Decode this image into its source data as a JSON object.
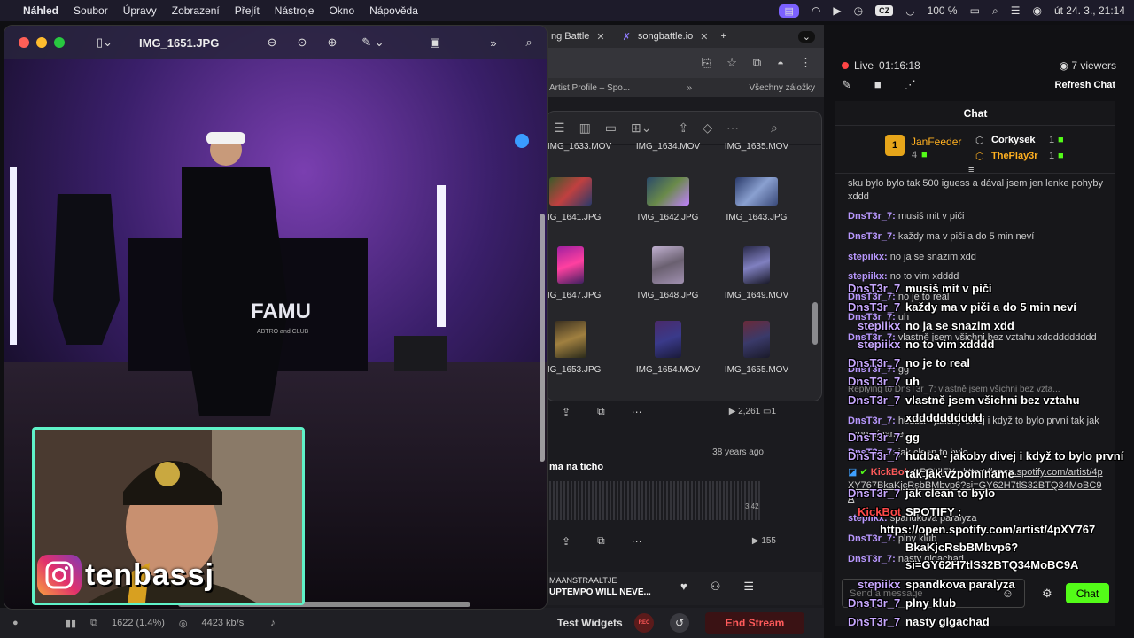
{
  "menubar": {
    "app": "Náhled",
    "items": [
      "Soubor",
      "Úpravy",
      "Zobrazení",
      "Přejít",
      "Nástroje",
      "Okno",
      "Nápověda"
    ],
    "lang": "CZ",
    "battery": "100 %",
    "datetime": "út 24. 3., 21:14"
  },
  "browser": {
    "tabs": [
      {
        "label": "ng Battle"
      },
      {
        "label": "songbattle.io"
      }
    ],
    "bookmark_left": "Artist Profile – Spo...",
    "bookmark_right": "Všechny záložky"
  },
  "finder": {
    "files": [
      "IMG_1633.MOV",
      "IMG_1634.MOV",
      "IMG_1635.MOV",
      "IMG_1641.JPG",
      "IMG_1642.JPG",
      "IMG_1643.JPG",
      "IMG_1647.JPG",
      "IMG_1648.JPG",
      "IMG_1649.MOV",
      "IMG_1653.JPG",
      "IMG_1654.MOV",
      "IMG_1655.MOV"
    ]
  },
  "feed": {
    "post1_count": "2,261",
    "post1_comments": "1",
    "ago": "38 years ago",
    "caption": "ma na ticho",
    "duration": "3:42",
    "post2_count": "155",
    "player_artist": "MAANSTRAALTJE",
    "player_title": "UPTEMPO WILL NEVE..."
  },
  "preview": {
    "title": "IMG_1651.JPG",
    "photo_sign": "FAMU",
    "photo_subsign": "ABTRO and CLUB"
  },
  "webcam": {
    "ig_handle": "tenbassj"
  },
  "streambar": {
    "frames": "1622 (1.4%)",
    "bitrate": "4423 kb/s",
    "test_widgets": "Test Widgets",
    "rec": "REC",
    "end_stream": "End Stream"
  },
  "stream": {
    "live": "Live",
    "timer": "01:16:18",
    "viewers": "7 viewers",
    "refresh": "Refresh Chat"
  },
  "chat": {
    "header": "Chat",
    "leaderboard": {
      "first_name": "JanFeeder",
      "first_count": "4",
      "second_name": "Corkysek",
      "second_count": "1",
      "third_name": "ThePlay3r",
      "third_count": "1"
    },
    "messages": [
      {
        "user": "",
        "text": "sku bylo bylo tak 500 iguess a dával jsem jen lenke pohyby xddd"
      },
      {
        "user": "DnsT3r_7:",
        "text": "musiš mit v piči"
      },
      {
        "user": "DnsT3r_7:",
        "text": "každy ma v piči a do 5 min neví"
      },
      {
        "user": "stepiikx:",
        "text": "no ja se snazim xdd"
      },
      {
        "user": "stepiikx:",
        "text": "no to vim xdddd"
      },
      {
        "user": "DnsT3r_7:",
        "text": "no je to real"
      },
      {
        "user": "DnsT3r_7:",
        "text": "uh"
      },
      {
        "user": "DnsT3r_7:",
        "text": "vlastně jsem všichni bez vztahu xdddddddddd"
      },
      {
        "user": "DnsT3r_7:",
        "text": "gg"
      },
      {
        "user": "",
        "text": "Replying to DnsT3r_7: vlastně jsem všichni bez vzta..."
      },
      {
        "user": "DnsT3r_7:",
        "text": "hudba - jakoby divej i když to bylo první tak jak vzpomíname"
      },
      {
        "user": "DnsT3r_7:",
        "text": "jak clean to bylo"
      },
      {
        "user": "KickBot:",
        "text": "SPOTIFY : https://open.spotify.com/artist/4pXY767BkaKjcRsbBMbvp6?si=GY62H7tlS32BTQ34MoBC9A"
      },
      {
        "user": "stepiikx:",
        "text": "spandkova paralyza"
      },
      {
        "user": "DnsT3r_7:",
        "text": "plny klub"
      },
      {
        "user": "DnsT3r_7:",
        "text": "nasty gigachad"
      }
    ],
    "input_placeholder": "Send a message",
    "send_label": "Chat"
  },
  "overlay": [
    {
      "user": "DnsT3r_7",
      "text": "musiš mit v piči"
    },
    {
      "user": "DnsT3r_7",
      "text": "každy ma v piči a do 5 min neví"
    },
    {
      "user": "stepiikx",
      "text": "no ja se snazim xdd"
    },
    {
      "user": "stepiikx",
      "text": "no to vim xdddd"
    },
    {
      "user": "DnsT3r_7",
      "text": "no je to real"
    },
    {
      "user": "DnsT3r_7",
      "text": "uh"
    },
    {
      "user": "DnsT3r_7",
      "text": "vlastně jsem všichni bez vztahu"
    },
    {
      "user": "",
      "text": "xdddddddddd"
    },
    {
      "user": "DnsT3r_7",
      "text": "gg"
    },
    {
      "user": "DnsT3r_7",
      "text": "hudba - jakoby divej i když to bylo první"
    },
    {
      "user": "",
      "text": "tak jak vzpomíname"
    },
    {
      "user": "DnsT3r_7",
      "text": "jak clean to bylo"
    },
    {
      "user": "KickBot",
      "text": "SPOTIFY :"
    },
    {
      "user": "",
      "text": "https://open.spotify.com/artist/4pXY767"
    },
    {
      "user": "",
      "text": "BkaKjcRsbBMbvp6?"
    },
    {
      "user": "",
      "text": "si=GY62H7tlS32BTQ34MoBC9A"
    },
    {
      "user": "stepiikx",
      "text": "spandkova paralyza"
    },
    {
      "user": "DnsT3r_7",
      "text": "plny klub"
    },
    {
      "user": "DnsT3r_7",
      "text": "nasty gigachad"
    }
  ]
}
